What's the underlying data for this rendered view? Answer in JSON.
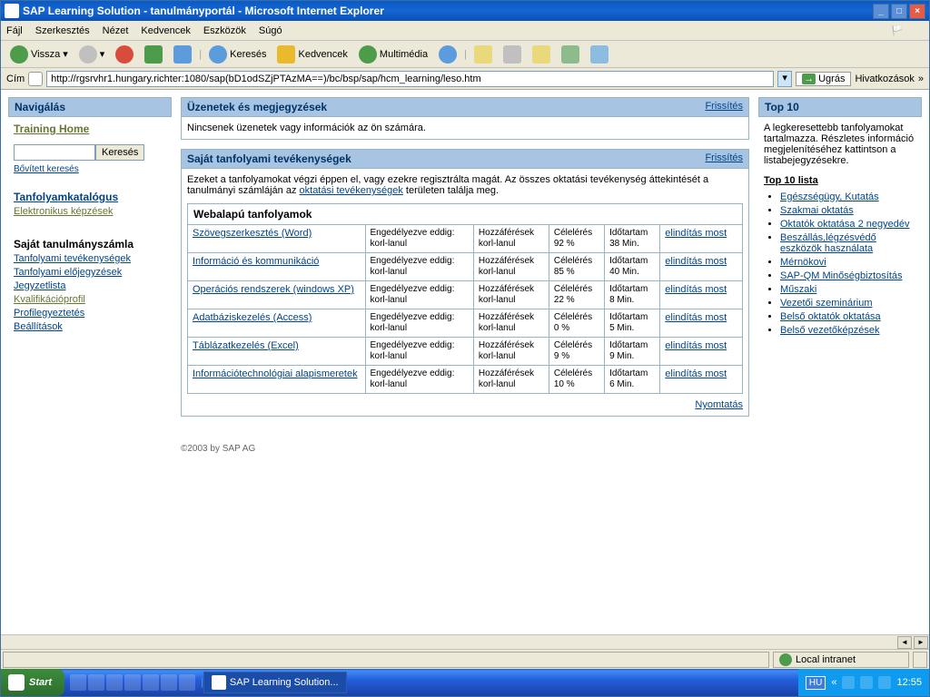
{
  "window": {
    "title": "SAP Learning Solution - tanulmányportál - Microsoft Internet Explorer"
  },
  "menu": {
    "file": "Fájl",
    "edit": "Szerkesztés",
    "view": "Nézet",
    "fav": "Kedvencek",
    "tools": "Eszközök",
    "help": "Súgó"
  },
  "toolbar": {
    "back": "Vissza",
    "search": "Keresés",
    "favorites": "Kedvencek",
    "media": "Multimédia"
  },
  "address": {
    "label": "Cím",
    "url": "http://rgsrvhr1.hungary.richter:1080/sap(bD1odSZjPTAzMA==)/bc/bsp/sap/hcm_learning/leso.htm",
    "go": "Ugrás",
    "links": "Hivatkozások"
  },
  "nav": {
    "title": "Navigálás",
    "home": "Training Home",
    "searchbtn": "Keresés",
    "advsearch": "Bővített keresés",
    "catalog": "Tanfolyamkatalógus",
    "ecourses": "Elektronikus képzések",
    "acct_title": "Saját tanulmányszámla",
    "activities": "Tanfolyami tevékenységek",
    "prebook": "Tanfolyami előjegyzések",
    "notes": "Jegyzetlista",
    "qual": "Kvalifikációprofil",
    "profmatch": "Profilegyeztetés",
    "settings": "Beállítások"
  },
  "messages": {
    "title": "Üzenetek és megjegyzések",
    "refresh": "Frissítés",
    "none": "Nincsenek üzenetek vagy információk az ön számára."
  },
  "activities": {
    "title": "Saját tanfolyami tevékenységek",
    "refresh": "Frissítés",
    "desc1": "Ezeket a tanfolyamokat végzi éppen el, vagy ezekre regisztrálta magát. Az összes oktatási tevékenység áttekintését a tanulmányi számláján az ",
    "desc_link": "oktatási tevékenységek",
    "desc2": " területen találja meg.",
    "wbt_header": "Webalapú tanfolyamok",
    "col": {
      "perm": "Engedélyezve eddig:",
      "access": "Hozzáférések",
      "goal": "Célelérés",
      "dur": "Időtartam"
    },
    "korl": "korl-lanul",
    "start": "elindítás most",
    "print": "Nyomtatás",
    "rows": [
      {
        "name": "Szövegszerkesztés (Word)",
        "goal": "92 %",
        "dur": "38 Min."
      },
      {
        "name": "Információ és kommunikáció",
        "goal": "85 %",
        "dur": "40 Min."
      },
      {
        "name": "Operációs rendszerek (windows XP)",
        "goal": "22 %",
        "dur": "8 Min."
      },
      {
        "name": "Adatbáziskezelés (Access)",
        "goal": "0 %",
        "dur": "5 Min."
      },
      {
        "name": "Táblázatkezelés (Excel)",
        "goal": "9 %",
        "dur": "9 Min."
      },
      {
        "name": "Információtechnológiai alapismeretek",
        "goal": "10 %",
        "dur": "6 Min."
      }
    ]
  },
  "top10": {
    "title": "Top 10",
    "desc": "A legkeresettebb tanfolyamokat tartalmazza. Részletes információ megjelenítéséhez kattintson a listabejegyzésekre.",
    "list_title": "Top 10 lista",
    "items": [
      "Egészségügy, Kutatás",
      "Szakmai oktatás",
      "Oktatók oktatása 2 negyedév",
      "Beszállás,légzésvédő eszközök használata",
      "Mérnökovi",
      "SAP-QM Minőségbiztosítás",
      "Műszaki",
      "Vezetői szeminárium",
      "Belső oktatók oktatása",
      "Belső vezetőképzések"
    ]
  },
  "footer": "©2003 by SAP AG",
  "status": {
    "zone": "Local intranet"
  },
  "taskbar": {
    "start": "Start",
    "app": "SAP Learning Solution...",
    "lang": "HU",
    "time": "12:55"
  }
}
